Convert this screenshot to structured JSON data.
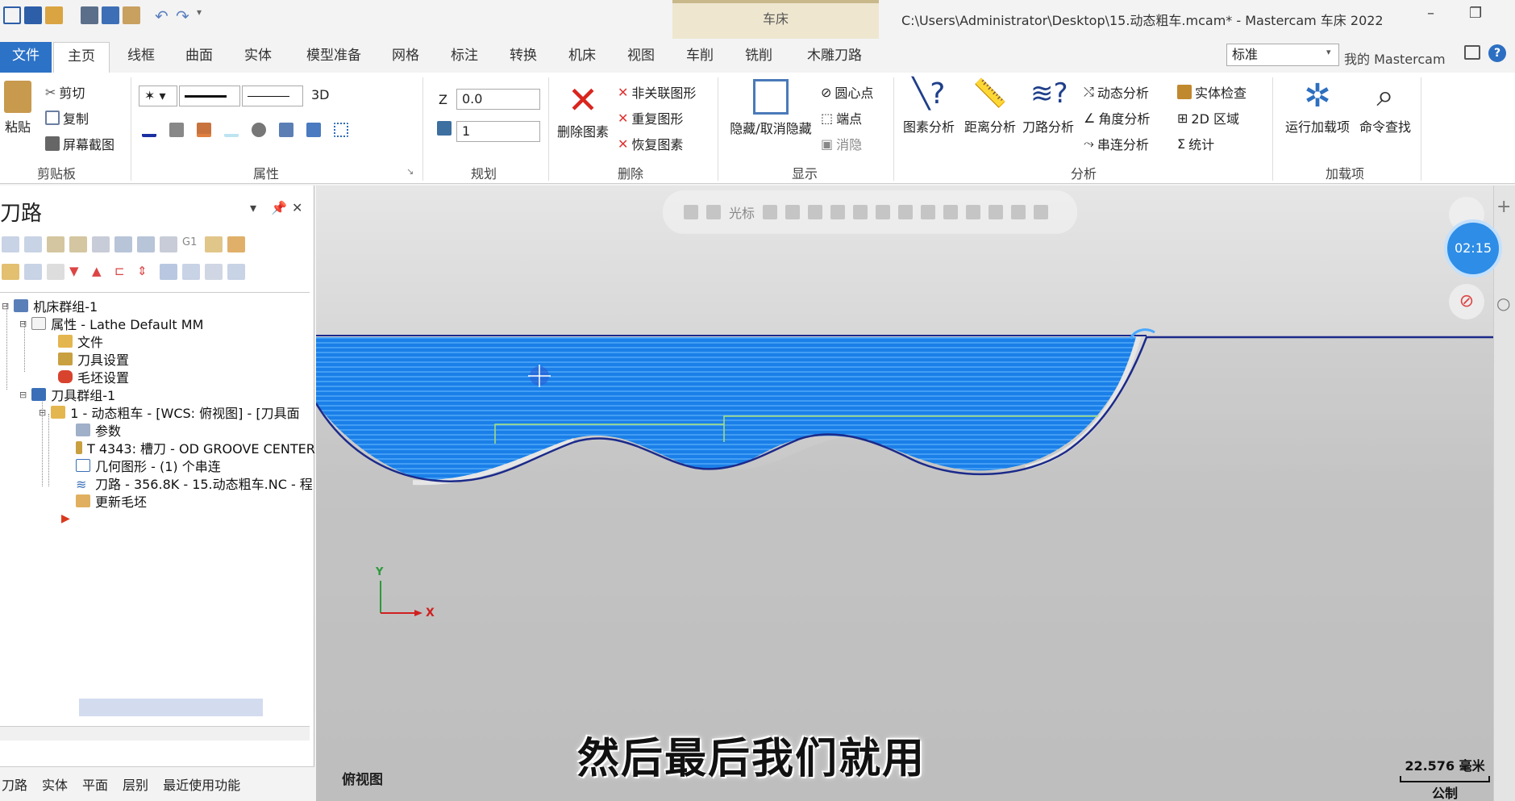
{
  "titlebar": {
    "context_tab": "车床",
    "title": "C:\\Users\\Administrator\\Desktop\\15.动态粗车.mcam* - Mastercam 车床 2022"
  },
  "ribbon_tabs": [
    "文件",
    "主页",
    "线框",
    "曲面",
    "实体",
    "模型准备",
    "网格",
    "标注",
    "转换",
    "机床",
    "视图",
    "车削",
    "铣削",
    "木雕刀路"
  ],
  "ribbon_right": {
    "style_select": "标准",
    "my_mastercam": "我的 Mastercam"
  },
  "groups": {
    "clipboard": {
      "label": "剪贴板",
      "paste": "粘贴",
      "cut": "剪切",
      "copy": "复制",
      "screenshot": "屏幕截图"
    },
    "attributes": {
      "label": "属性",
      "three_d": "3D"
    },
    "planning": {
      "label": "规划",
      "z_label": "Z",
      "z_value": "0.0",
      "level_value": "1"
    },
    "delete": {
      "label": "删除",
      "delete_entities": "删除图素",
      "non_assoc": "非关联图形",
      "duplicate": "重复图形",
      "restore": "恢复图素"
    },
    "display": {
      "label": "显示",
      "hide_unhide": "隐藏/取消隐藏",
      "center_point": "圆心点",
      "endpoints": "端点",
      "blank": "消隐"
    },
    "analyze": {
      "label": "分析",
      "entity": "图素分析",
      "distance": "距离分析",
      "toolpath": "刀路分析",
      "dynamic": "动态分析",
      "angle": "角度分析",
      "chain": "串连分析",
      "solid_check": "实体检查",
      "region_2d": "2D 区域",
      "statistics": "统计"
    },
    "addins": {
      "label": "加载项",
      "run": "运行加载项",
      "find": "命令查找"
    }
  },
  "panel": {
    "title": "刀路",
    "tree": [
      "机床群组-1",
      "属性 - Lathe Default MM",
      "文件",
      "刀具设置",
      "毛坯设置",
      "刀具群组-1",
      "1 - 动态粗车 - [WCS: 俯视图] - [刀具面",
      "参数",
      "T 4343: 槽刀 - OD GROOVE CENTER -",
      "几何图形 - (1) 个串连",
      "刀路 - 356.8K - 15.动态粗车.NC - 程",
      "更新毛坯"
    ],
    "bottom_tabs": [
      "刀路",
      "实体",
      "平面",
      "层别",
      "最近使用功能"
    ]
  },
  "viewport": {
    "cursor_label": "光标",
    "view_name": "俯视图",
    "scale_value": "22.576 毫米",
    "units": "公制",
    "axis_x": "X",
    "axis_y": "Y",
    "subtitle": "然后最后我们就用",
    "timer": "02:15"
  },
  "colors": {
    "accent": "#2c72c7",
    "toolpath": "#1a7fe8",
    "boundary": "#1b2a8a",
    "context_tab": "#eee6cf"
  }
}
